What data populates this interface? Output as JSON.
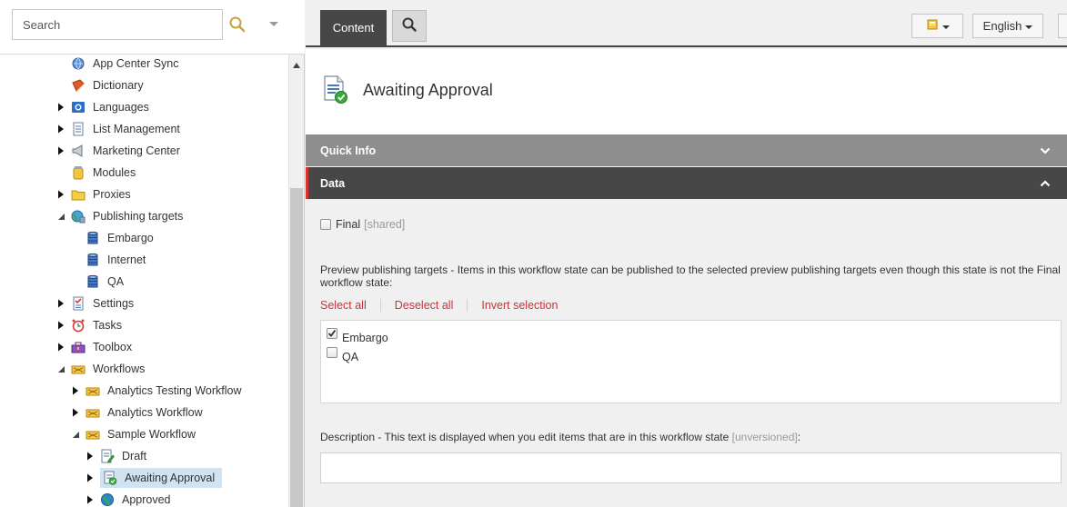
{
  "search": {
    "placeholder": "Search"
  },
  "tree": [
    {
      "label": "App Center Sync",
      "icon": "sync-globe-icon",
      "expanded": null
    },
    {
      "label": "Dictionary",
      "icon": "book-icon",
      "expanded": null
    },
    {
      "label": "Languages",
      "icon": "languages-icon",
      "expanded": false
    },
    {
      "label": "List Management",
      "icon": "list-document-icon",
      "expanded": false
    },
    {
      "label": "Marketing Center",
      "icon": "megaphone-icon",
      "expanded": false
    },
    {
      "label": "Modules",
      "icon": "modules-jar-icon",
      "expanded": null
    },
    {
      "label": "Proxies",
      "icon": "folder-icon",
      "expanded": false
    },
    {
      "label": "Publishing targets",
      "icon": "publishing-globe-icon",
      "expanded": true
    },
    {
      "label": "Embargo",
      "icon": "database-icon",
      "expanded": null
    },
    {
      "label": "Internet",
      "icon": "database-icon",
      "expanded": null
    },
    {
      "label": "QA",
      "icon": "database-icon",
      "expanded": null
    },
    {
      "label": "Settings",
      "icon": "settings-checklist-icon",
      "expanded": false
    },
    {
      "label": "Tasks",
      "icon": "alarm-clock-icon",
      "expanded": false
    },
    {
      "label": "Toolbox",
      "icon": "toolbox-icon",
      "expanded": false
    },
    {
      "label": "Workflows",
      "icon": "workflow-icon",
      "expanded": true
    },
    {
      "label": "Analytics Testing Workflow",
      "icon": "workflow-icon",
      "expanded": false
    },
    {
      "label": "Analytics Workflow",
      "icon": "workflow-icon",
      "expanded": false
    },
    {
      "label": "Sample Workflow",
      "icon": "workflow-icon",
      "expanded": true
    },
    {
      "label": "Draft",
      "icon": "document-edit-icon",
      "expanded": false
    },
    {
      "label": "Awaiting Approval",
      "icon": "document-check-icon",
      "expanded": false,
      "selected": true
    },
    {
      "label": "Approved",
      "icon": "globe-icon",
      "expanded": false
    }
  ],
  "toolbar": {
    "content_tab": "Content",
    "language": "English"
  },
  "item": {
    "title": "Awaiting Approval"
  },
  "sections": {
    "quick_info": "Quick Info",
    "data": "Data"
  },
  "fields": {
    "final_label": "Final",
    "final_checked": false,
    "shared_tag": "[shared]",
    "preview_label": "Preview publishing targets - Items in this workflow state can be published to the selected preview publishing targets even though this state is not the Final workflow state:",
    "select_all": "Select all",
    "deselect_all": "Deselect all",
    "invert_selection": "Invert selection",
    "targets": [
      {
        "label": "Embargo",
        "checked": true
      },
      {
        "label": "QA",
        "checked": false
      }
    ],
    "description_label": "Description - This text is displayed when you edit items that are in this workflow state",
    "unversioned_tag": "[unversioned]",
    "description_suffix": ":",
    "description_value": ""
  },
  "colors": {
    "dark_header": "#474747",
    "grey_header": "#8e8e8e",
    "accent_red": "#d9352e",
    "link_red": "#c8333a",
    "selection_blue": "#cfe3f3"
  }
}
